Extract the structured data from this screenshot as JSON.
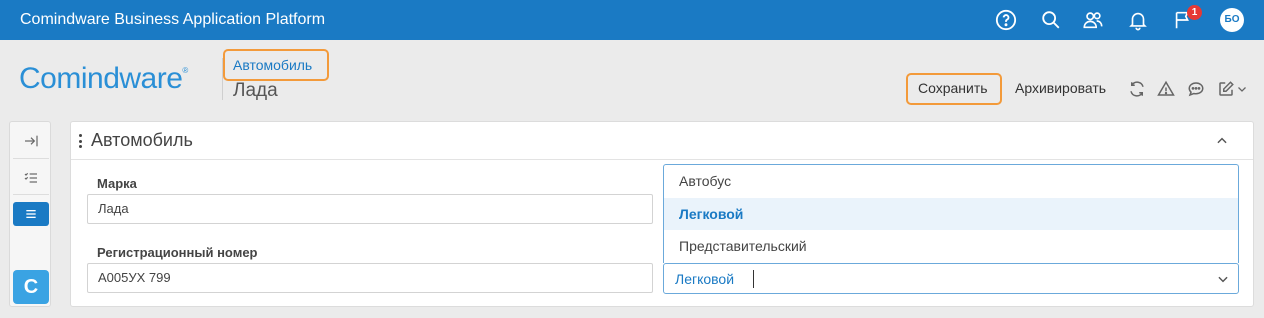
{
  "topbar": {
    "title": "Comindware Business Application Platform",
    "icons": [
      "help-icon",
      "search-icon",
      "users-icon",
      "bell-icon",
      "flag-icon"
    ],
    "notification_count": "1",
    "avatar_initials": "БО",
    "color": "#1a7ac4"
  },
  "header": {
    "logo_text": "Comindware",
    "logo_mark": "®",
    "breadcrumb": "Автомобиль",
    "title": "Лада"
  },
  "toolbar": {
    "save_label": "Сохранить",
    "archive_label": "Архивировать",
    "icons": [
      "refresh-icon",
      "warning-icon",
      "comment-icon",
      "edit-icon"
    ]
  },
  "sidenav": {
    "items": [
      "collapse-panel-icon",
      "checklist-icon",
      "menu-icon"
    ],
    "app_letter": "C"
  },
  "form": {
    "section_title": "Автомобиль",
    "fields": [
      {
        "label": "Марка",
        "value": "Лада"
      },
      {
        "label": "Регистрационный номер",
        "value": "А005УХ 799"
      }
    ],
    "dropdown": {
      "value": "Легковой",
      "options": [
        "Автобус",
        "Легковой",
        "Представительский"
      ],
      "selected_index": 1
    }
  },
  "colors": {
    "accent": "#1a7ac4",
    "highlight": "#f39a3a",
    "badge": "#e53935"
  }
}
